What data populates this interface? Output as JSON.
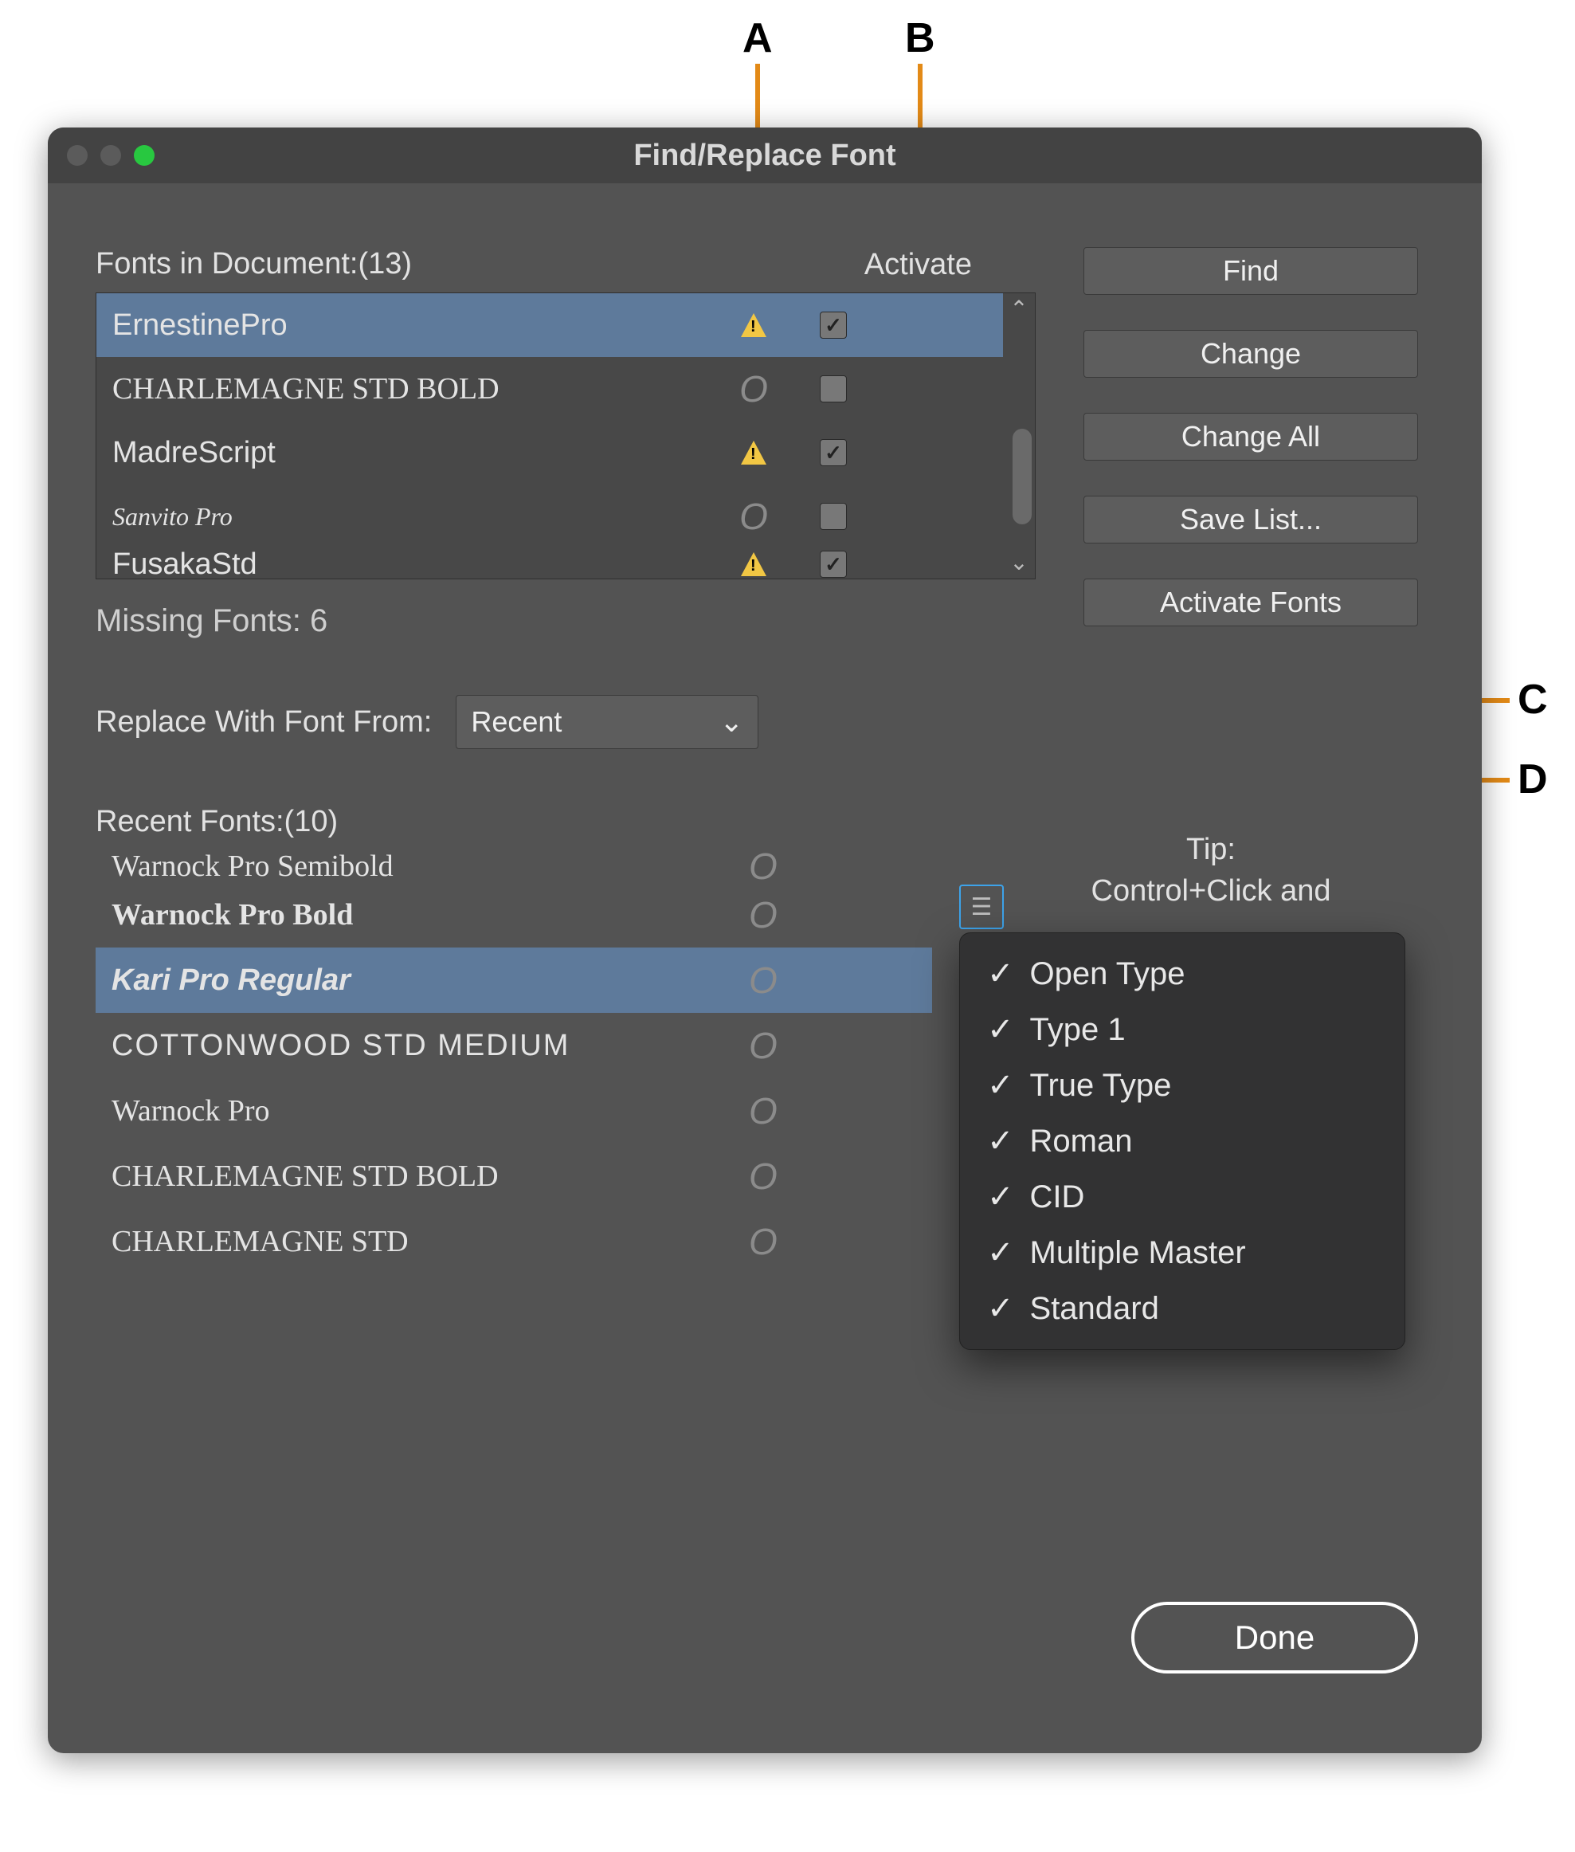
{
  "window": {
    "title": "Find/Replace Font"
  },
  "callouts": {
    "a": "A",
    "b": "B",
    "c": "C",
    "d": "D"
  },
  "fontsInDoc": {
    "label": "Fonts in Document:(13)",
    "activateHeader": "Activate",
    "rows": [
      {
        "name": "ErnestinePro",
        "glyph": "",
        "warn": true,
        "checked": true,
        "selected": true
      },
      {
        "name": "CHARLEMAGNE STD BOLD",
        "glyph": "O",
        "warn": false,
        "checked": false,
        "selected": false
      },
      {
        "name": "MadreScript",
        "glyph": "",
        "warn": true,
        "checked": true,
        "selected": false
      },
      {
        "name": "Sanvito Pro",
        "glyph": "O",
        "warn": false,
        "checked": false,
        "selected": false
      },
      {
        "name": "FusakaStd",
        "glyph": "",
        "warn": true,
        "checked": true,
        "selected": false,
        "cut": true
      }
    ]
  },
  "buttons": {
    "find": "Find",
    "change": "Change",
    "changeAll": "Change All",
    "saveList": "Save List...",
    "activateFonts": "Activate Fonts",
    "done": "Done"
  },
  "missing": "Missing Fonts: 6",
  "replaceWith": {
    "label": "Replace With Font From:",
    "value": "Recent"
  },
  "recent": {
    "label": "Recent Fonts:(10)",
    "rows": [
      {
        "name": "Warnock Pro Semibold",
        "glyph": "O",
        "selected": false,
        "cut": true
      },
      {
        "name": "Warnock Pro Bold",
        "glyph": "O",
        "selected": false
      },
      {
        "name": "Kari Pro Regular",
        "glyph": "O",
        "selected": true
      },
      {
        "name": "COTTONWOOD STD MEDIUM",
        "glyph": "O",
        "selected": false
      },
      {
        "name": "Warnock Pro",
        "glyph": "O",
        "selected": false
      },
      {
        "name": "CHARLEMAGNE STD BOLD",
        "glyph": "O",
        "selected": false
      },
      {
        "name": "CHARLEMAGNE STD",
        "glyph": "O",
        "selected": false
      }
    ]
  },
  "tip": {
    "line1": "Tip:",
    "line2": "Control+Click and"
  },
  "filterMenu": {
    "items": [
      {
        "checked": true,
        "label": "Open Type"
      },
      {
        "checked": true,
        "label": "Type 1"
      },
      {
        "checked": true,
        "label": "True Type"
      },
      {
        "checked": true,
        "label": "Roman"
      },
      {
        "checked": true,
        "label": "CID"
      },
      {
        "checked": true,
        "label": "Multiple Master"
      },
      {
        "checked": true,
        "label": "Standard"
      }
    ]
  }
}
